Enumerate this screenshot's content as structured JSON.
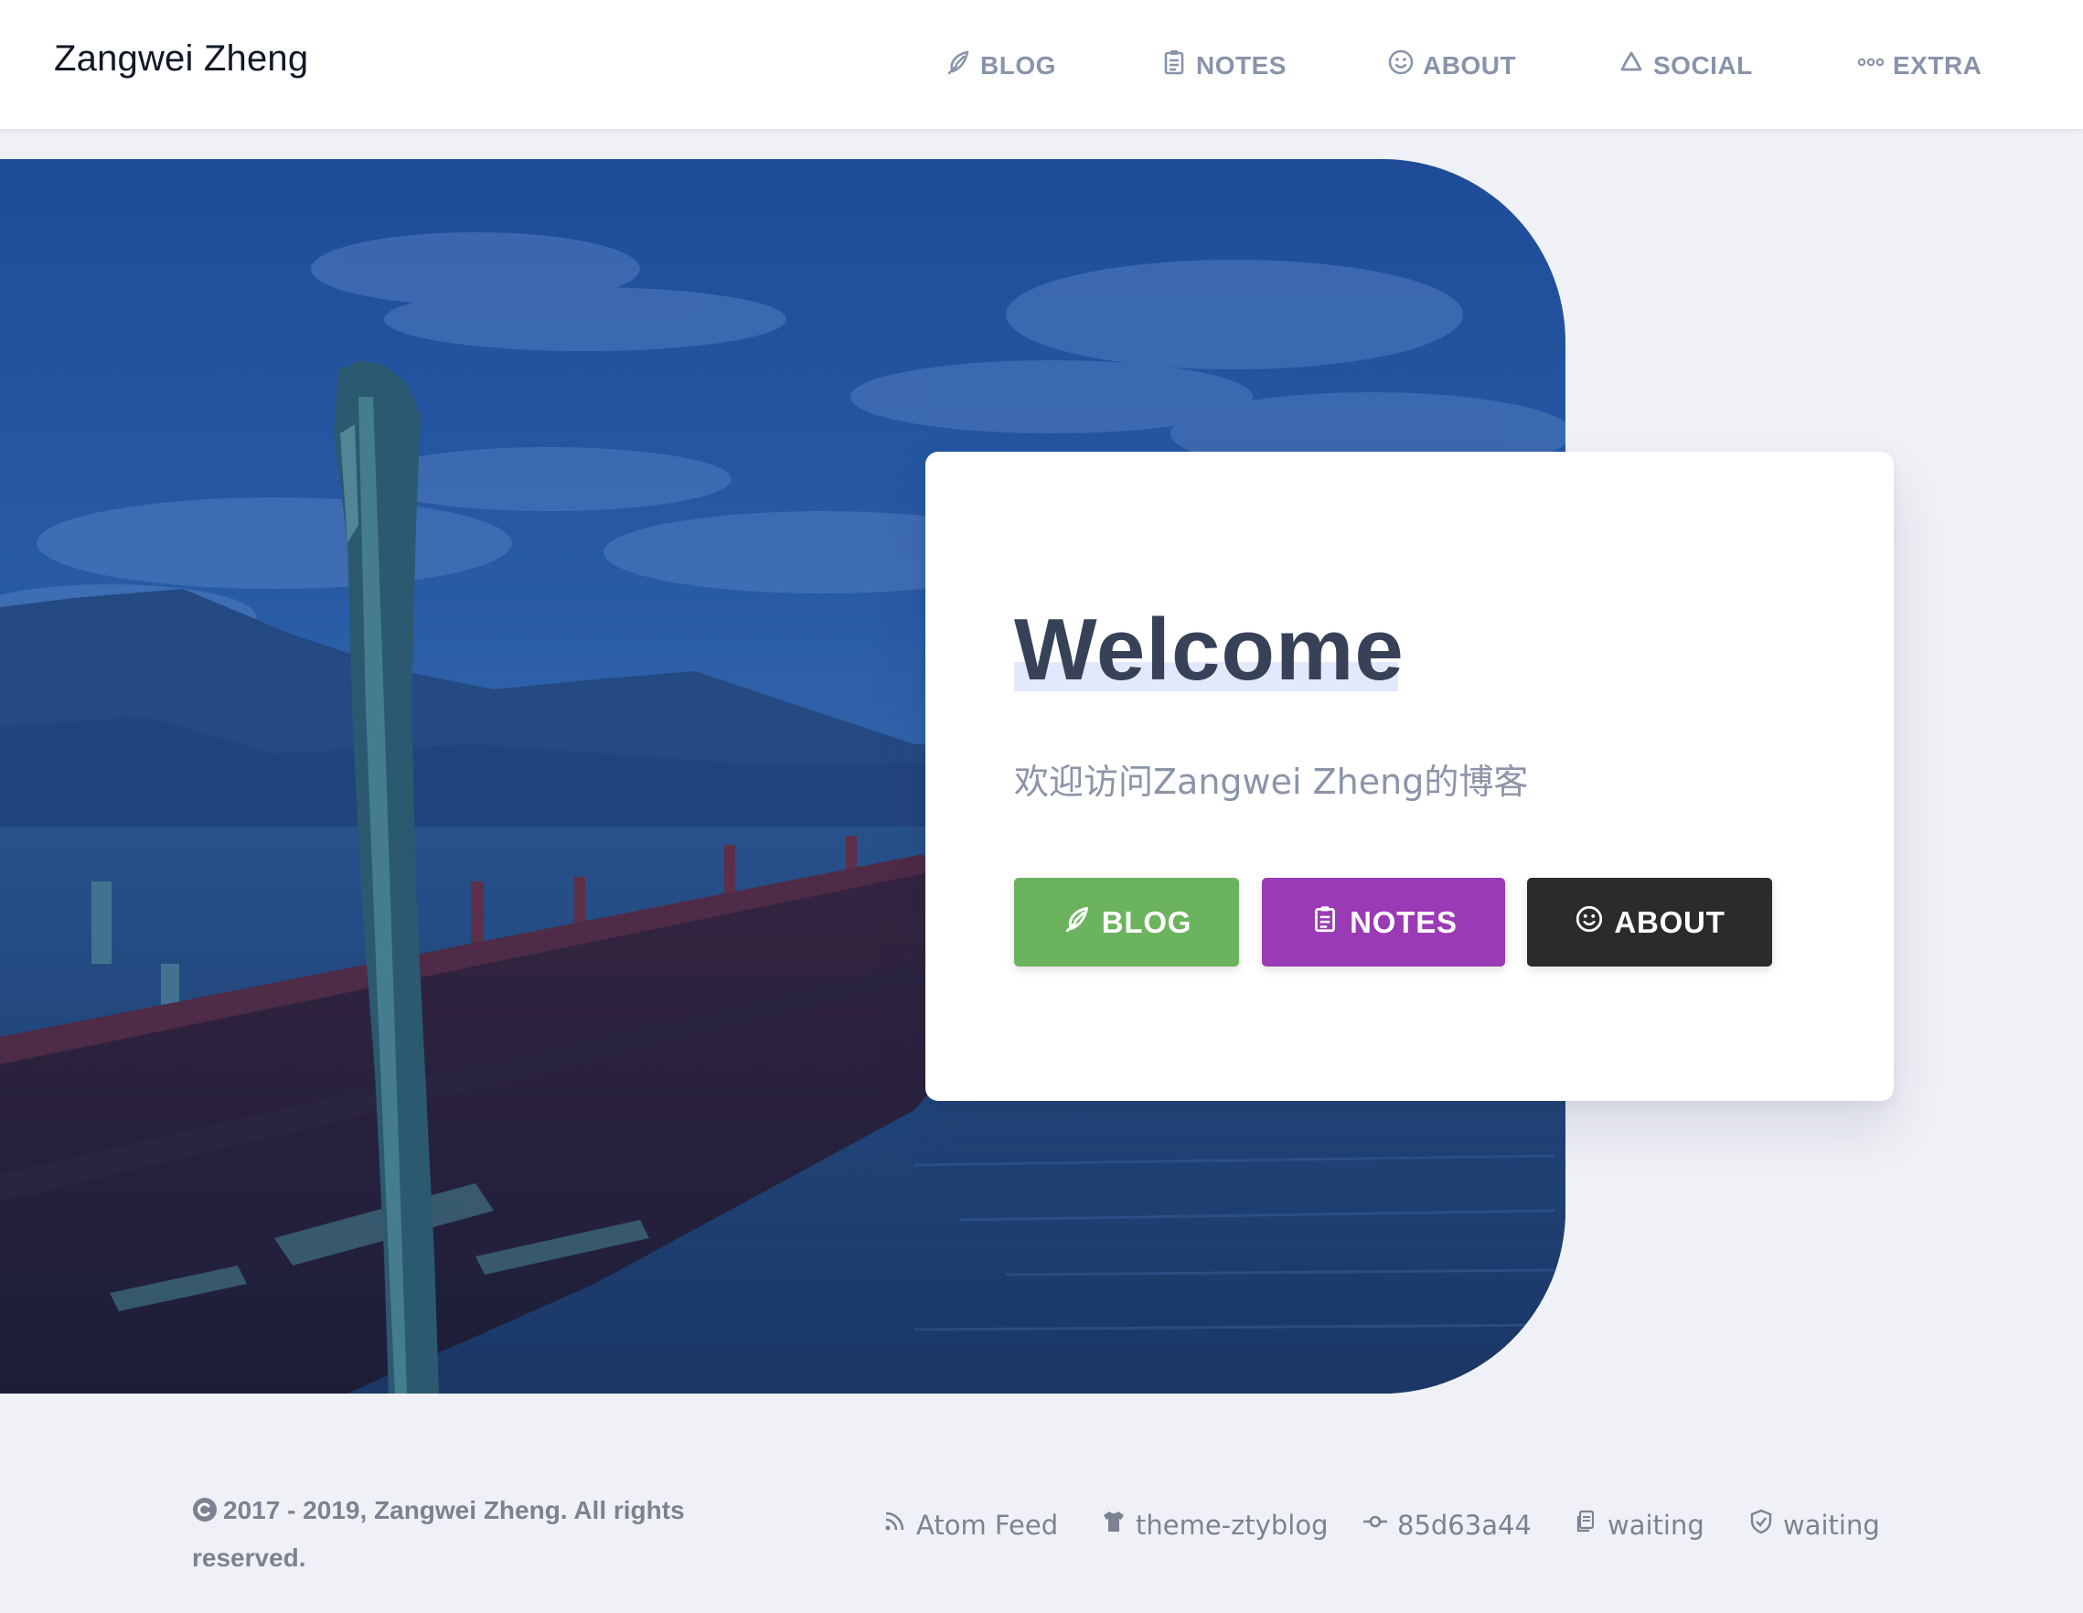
{
  "header": {
    "brand": "Zangwei Zheng",
    "nav": [
      {
        "label": "BLOG",
        "icon": "feather-icon"
      },
      {
        "label": "NOTES",
        "icon": "clipboard-icon"
      },
      {
        "label": "ABOUT",
        "icon": "smiley-icon"
      },
      {
        "label": "SOCIAL",
        "icon": "recycle-icon"
      },
      {
        "label": "EXTRA",
        "icon": "dots-icon"
      }
    ]
  },
  "hero": {
    "image": "lake-boat-photo"
  },
  "card": {
    "title": "Welcome",
    "subtitle": "欢迎访问Zangwei Zheng的博客",
    "buttons": [
      {
        "label": "BLOG",
        "icon": "feather-icon",
        "color": "#6bb35e"
      },
      {
        "label": "NOTES",
        "icon": "clipboard-icon",
        "color": "#9a3ab4"
      },
      {
        "label": "ABOUT",
        "icon": "smiley-icon",
        "color": "#2b2b2b"
      }
    ]
  },
  "footer": {
    "copyright": "2017 - 2019, Zangwei Zheng. All rights reserved.",
    "links": [
      {
        "label": "Atom Feed",
        "icon": "rss-icon"
      },
      {
        "label": "theme-ztyblog",
        "icon": "tshirt-icon"
      },
      {
        "label": "85d63a44",
        "icon": "commit-icon"
      },
      {
        "label": "waiting",
        "icon": "copy-icon"
      },
      {
        "label": "waiting",
        "icon": "shield-icon"
      }
    ]
  },
  "colors": {
    "background": "#f0f1f6",
    "nav_text": "#8794aa",
    "title": "#374259",
    "title_highlight": "#e3e8fb"
  }
}
